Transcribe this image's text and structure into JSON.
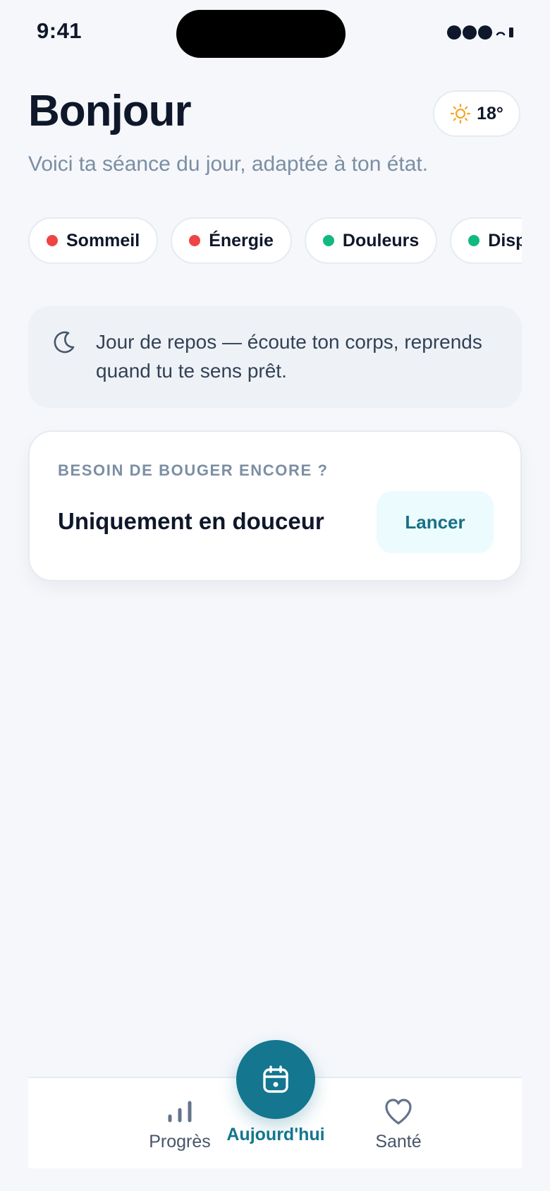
{
  "status_bar": {
    "time": "9:41"
  },
  "header": {
    "greeting": "Bonjour",
    "subtitle": "Voici ta séance du jour, adaptée à ton état.",
    "weather": {
      "icon": "sun-icon",
      "temperature": "18°"
    }
  },
  "chips": [
    {
      "label": "Sommeil",
      "status_color": "#ef4444"
    },
    {
      "label": "Énergie",
      "status_color": "#ef4444"
    },
    {
      "label": "Douleurs",
      "status_color": "#10b981"
    },
    {
      "label": "Dispo",
      "status_color": "#10b981"
    }
  ],
  "rest_card": {
    "icon": "moon-icon",
    "text": "Jour de repos — écoute ton corps, reprends quand tu te sens prêt."
  },
  "gentle_card": {
    "eyebrow": "BESOIN DE BOUGER ENCORE ?",
    "title": "Uniquement en douceur",
    "button_label": "Lancer"
  },
  "bottom_nav": {
    "items": [
      {
        "label": "Progrès",
        "icon": "bar-chart-icon"
      },
      {
        "label": "Aujourd'hui",
        "icon": "calendar-icon",
        "active": true
      },
      {
        "label": "Santé",
        "icon": "heart-icon"
      }
    ]
  },
  "colors": {
    "accent": "#14768f",
    "background": "#f5f7fb",
    "muted_text": "#7b8ea3",
    "status_red": "#ef4444",
    "status_green": "#10b981"
  }
}
